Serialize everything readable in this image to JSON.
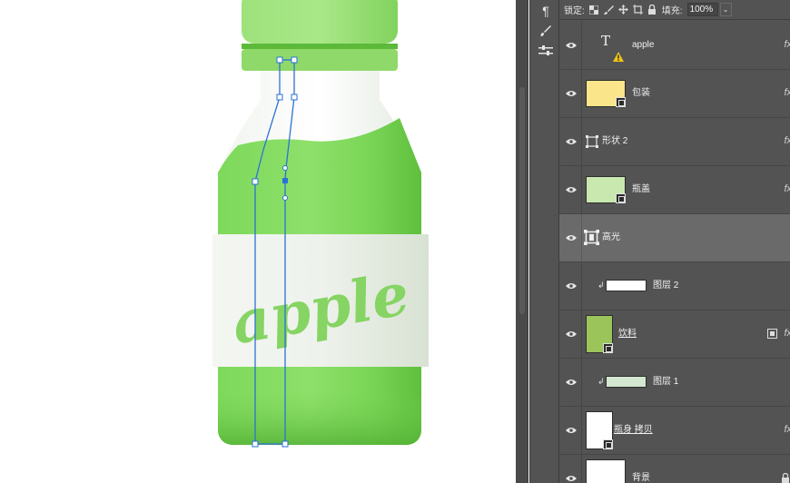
{
  "layers_panel": {
    "lock_label": "锁定:",
    "fill_label": "填充:",
    "fill_value": "100%",
    "layers": [
      {
        "name": "apple",
        "kind": "text",
        "has_fx": true,
        "warning": true
      },
      {
        "name": "包装",
        "kind": "pixel",
        "thumb_color": "#fbe58a",
        "has_fx": true
      },
      {
        "name": "形状 2",
        "kind": "shape",
        "has_fx": true
      },
      {
        "name": "瓶盖",
        "kind": "pixel",
        "thumb_color": "#c8e8b0",
        "has_fx": true
      },
      {
        "name": "高光",
        "kind": "shape",
        "selected": true
      },
      {
        "name": "图层 2",
        "kind": "clipped",
        "thumb_color": "#ffffff"
      },
      {
        "name": "饮料",
        "kind": "pixel",
        "thumb_color": "#9bc45b",
        "has_fx": true,
        "linked_mask": true
      },
      {
        "name": "图层 1",
        "kind": "clipped",
        "thumb_color": "#d4e7d0"
      },
      {
        "name": "瓶身 拷贝",
        "kind": "pixel",
        "thumb_color": "#ffffff",
        "has_fx": true
      },
      {
        "name": "背景",
        "kind": "pixel",
        "thumb_color": "#ffffff",
        "locked": true
      }
    ]
  },
  "canvas": {
    "label_text": "apple",
    "colors": {
      "bottle_green": "#6fcf4f",
      "cap_green": "#8fde6c",
      "label_white": "#eef2ec",
      "path_blue": "#2b72d6"
    }
  },
  "tools": [
    "paragraph-icon",
    "brush-settings-icon",
    "adjustments-icon"
  ]
}
